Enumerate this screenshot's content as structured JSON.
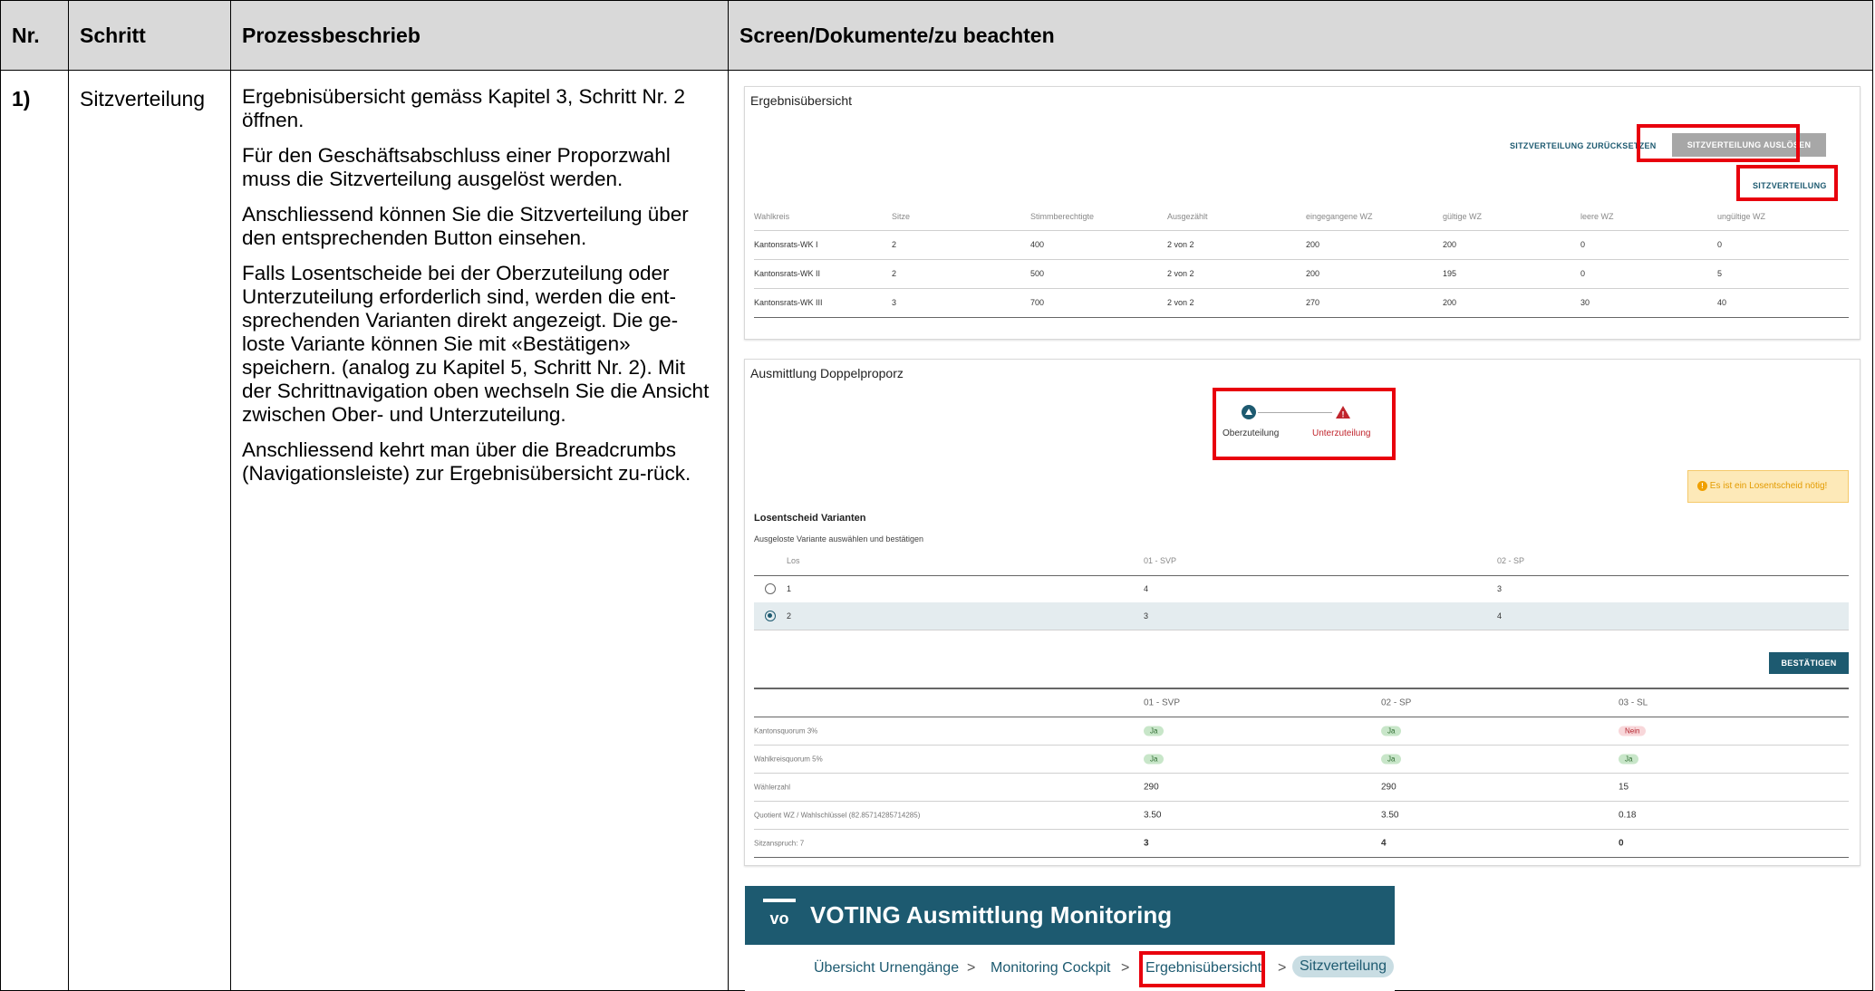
{
  "header": {
    "nr": "Nr.",
    "step": "Schritt",
    "desc": "Prozessbeschrieb",
    "screen": "Screen/Dokumente/zu beachten"
  },
  "row": {
    "nr": "1)",
    "step": "Sitzverteilung",
    "paragraphs": [
      "Ergebnisübersicht gemäss Kapitel 3, Schritt Nr. 2 öffnen.",
      "Für den Geschäftsabschluss einer Proporzwahl muss die Sitzverteilung ausgelöst werden.",
      "Anschliessend können Sie die Sitzverteilung über den entsprechenden Button einsehen.",
      "Falls Losentscheide bei der Oberzuteilung oder Unterzuteilung erforderlich sind, werden die ent-sprechenden Varianten direkt angezeigt. Die ge-loste Variante können Sie mit «Bestätigen» speichern. (analog zu Kapitel 5, Schritt Nr. 2). Mit der Schrittnavigation oben wechseln Sie die Ansicht zwischen Ober- und Unterzuteilung.",
      "Anschliessend kehrt man über die Breadcrumbs (Navigationsleiste) zur Ergebnisübersicht zu-rück."
    ]
  },
  "ergebnis": {
    "title": "Ergebnisübersicht",
    "reset_label": "SITZVERTEILUNG ZURÜCKSETZEN",
    "trigger_label": "SITZVERTEILUNG AUSLÖSEN",
    "view_label": "SITZVERTEILUNG",
    "columns": [
      "Wahlkreis",
      "Sitze",
      "Stimmberechtigte",
      "Ausgezählt",
      "eingegangene WZ",
      "gültige WZ",
      "leere WZ",
      "ungültige WZ"
    ],
    "rows": [
      [
        "Kantonsrats-WK I",
        "2",
        "400",
        "2 von 2",
        "200",
        "200",
        "0",
        "0"
      ],
      [
        "Kantonsrats-WK II",
        "2",
        "500",
        "2 von 2",
        "200",
        "195",
        "0",
        "5"
      ],
      [
        "Kantonsrats-WK III",
        "3",
        "700",
        "2 von 2",
        "270",
        "200",
        "30",
        "40"
      ]
    ]
  },
  "doppel": {
    "title": "Ausmittlung Doppelproporz",
    "step1": "Oberzuteilung",
    "step2": "Unterzuteilung",
    "alert": "Es ist ein Losentscheid nötig!",
    "los_title": "Losentscheid Varianten",
    "los_subtitle": "Ausgeloste Variante auswählen und bestätigen",
    "los_headers": [
      "Los",
      "01 - SVP",
      "02 - SP"
    ],
    "los_rows": [
      {
        "los": "1",
        "a": "4",
        "b": "3",
        "selected": false
      },
      {
        "los": "2",
        "a": "3",
        "b": "4",
        "selected": true
      }
    ],
    "confirm_label": "BESTÄTIGEN",
    "party_headers": [
      "01 - SVP",
      "02 - SP",
      "03 - SL"
    ],
    "quorum_rows": [
      {
        "label": "Kantonsquorum 3%",
        "values": [
          "Ja",
          "Ja",
          "Nein"
        ]
      },
      {
        "label": "Wahlkreisquorum 5%",
        "values": [
          "Ja",
          "Ja",
          "Ja"
        ]
      }
    ],
    "value_rows": [
      {
        "label": "Wählerzahl",
        "values": [
          "290",
          "290",
          "15"
        ]
      },
      {
        "label": "Quotient WZ / Wahlschlüssel (82.85714285714285)",
        "values": [
          "3.50",
          "3.50",
          "0.18"
        ]
      },
      {
        "label": "Sitzanspruch: 7",
        "values": [
          "3",
          "4",
          "0"
        ]
      }
    ]
  },
  "voting": {
    "logo": "vo",
    "title": "VOTING Ausmittlung Monitoring",
    "breadcrumbs": [
      "Übersicht Urnengänge",
      "Monitoring Cockpit",
      "Ergebnisübersicht",
      "Sitzverteilung"
    ],
    "separator": ">"
  },
  "colors": {
    "brand": "#1d5a70",
    "highlight": "#e8000d",
    "warning_bg": "#fde9b8"
  }
}
